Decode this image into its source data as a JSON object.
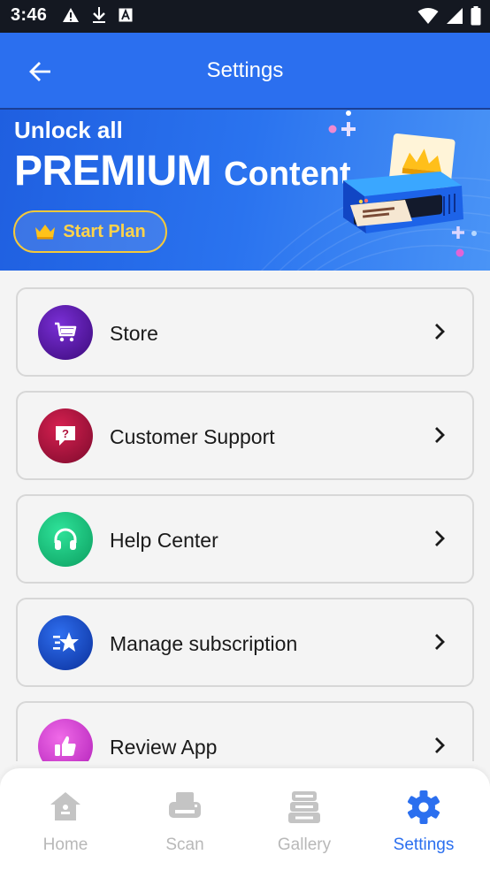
{
  "status_bar": {
    "time": "3:46"
  },
  "app_bar": {
    "title": "Settings",
    "back_icon": "arrow-left-icon"
  },
  "banner": {
    "line1": "Unlock all",
    "premium": "PREMIUM",
    "content": "Content",
    "cta_label": "Start Plan",
    "cta_icon": "crown-icon"
  },
  "menu": {
    "items": [
      {
        "label": "Store",
        "icon": "cart-icon",
        "color": "#5a12a8"
      },
      {
        "label": "Customer Support",
        "icon": "help-chat-icon",
        "color": "#b0123c"
      },
      {
        "label": "Help Center",
        "icon": "headphones-icon",
        "color": "#12c07a"
      },
      {
        "label": "Manage subscription",
        "icon": "star-list-icon",
        "color": "#1b4fc8"
      },
      {
        "label": "Review App",
        "icon": "thumbs-up-icon",
        "color": "#d43ad8"
      }
    ]
  },
  "bottom_nav": {
    "items": [
      {
        "label": "Home",
        "icon": "home-icon",
        "active": false
      },
      {
        "label": "Scan",
        "icon": "printer-icon",
        "active": false
      },
      {
        "label": "Gallery",
        "icon": "stack-icon",
        "active": false
      },
      {
        "label": "Settings",
        "icon": "gear-icon",
        "active": true
      }
    ],
    "active_color": "#2b6fef",
    "inactive_color": "#b8b8b8"
  }
}
